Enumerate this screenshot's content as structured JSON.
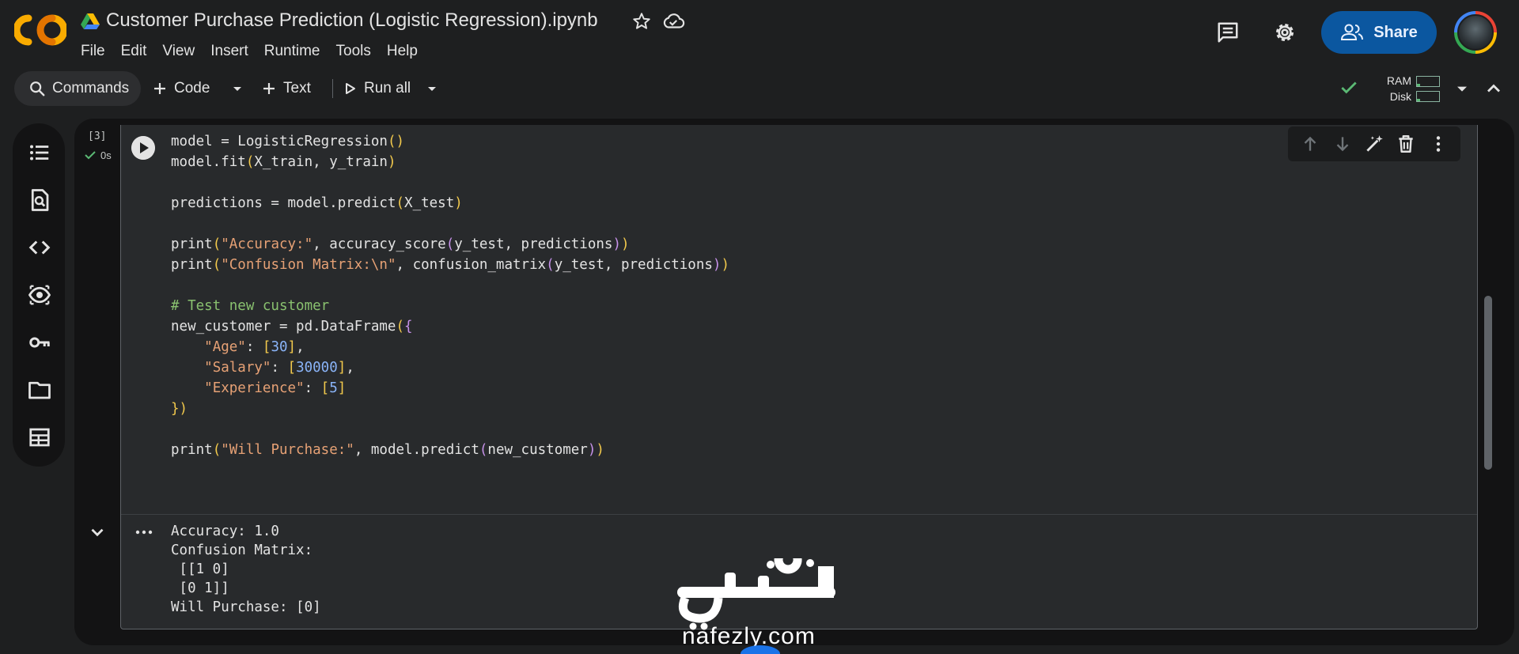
{
  "app": {
    "logo_text": "CO",
    "notebook_title": "Customer Purchase Prediction (Logistic Regression).ipynb"
  },
  "menu": [
    "File",
    "Edit",
    "View",
    "Insert",
    "Runtime",
    "Tools",
    "Help"
  ],
  "header": {
    "share_label": "Share",
    "icons": [
      "comment-icon",
      "gear-icon",
      "star-icon",
      "cloud-icon",
      "drive-icon"
    ]
  },
  "toolbar": {
    "commands_label": "Commands",
    "code_label": "Code",
    "text_label": "Text",
    "run_all_label": "Run all",
    "ram_label": "RAM",
    "disk_label": "Disk",
    "ram_usage": 0.15,
    "disk_usage": 0.15
  },
  "cell": {
    "execution_count": "[3]",
    "execution_time": "0s",
    "code_lines": [
      "model = LogisticRegression()",
      "model.fit(X_train, y_train)",
      "",
      "predictions = model.predict(X_test)",
      "",
      "print(\"Accuracy:\", accuracy_score(y_test, predictions))",
      "print(\"Confusion Matrix:\\n\", confusion_matrix(y_test, predictions))",
      "",
      "# Test new customer",
      "new_customer = pd.DataFrame({",
      "    \"Age\": [30],",
      "    \"Salary\": [30000],",
      "    \"Experience\": [5]",
      "})",
      "",
      "print(\"Will Purchase:\", model.predict(new_customer))"
    ],
    "output_lines": [
      "Accuracy: 1.0",
      "Confusion Matrix:",
      " [[1 0]",
      " [0 1]]",
      "Will Purchase: [0]"
    ]
  },
  "watermark": {
    "arabic_text": "نفذلي",
    "domain": "nafezly.com"
  },
  "colors": {
    "share_bg": "#0b57a0",
    "string": "#e6a175",
    "number": "#8ab4f8",
    "comment": "#89c16f",
    "check": "#5bb974"
  }
}
